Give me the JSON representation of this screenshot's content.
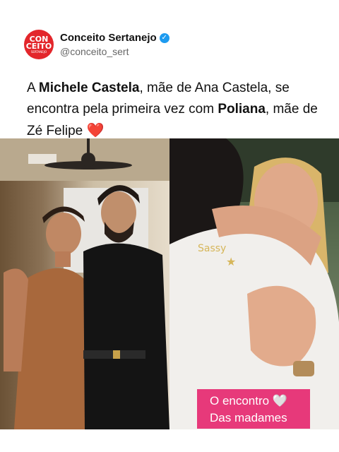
{
  "profile": {
    "avatar_line1": "CON",
    "avatar_line2": "CEITO",
    "avatar_line3": "SERTANEJO",
    "display_name": "Conceito Sertanejo",
    "verified_icon": "✓",
    "handle": "@conceito_sert"
  },
  "post": {
    "text_1": "A ",
    "name_1": "Michele Castela",
    "text_2": ", mãe de Ana Castela, se encontra pela primeira vez com ",
    "name_2": "Poliana",
    "text_3": ", mãe de Zé Felipe ",
    "heart": "❤️"
  },
  "caption": {
    "line1": "O encontro 🤍",
    "line2": "Das madames"
  },
  "colors": {
    "brand": "#e3262b",
    "verified": "#1d9bf0",
    "caption_bg": "#e7397a"
  }
}
